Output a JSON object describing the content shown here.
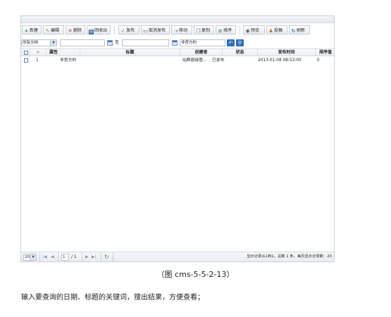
{
  "toolbar": {
    "new": "新建",
    "edit": "编辑",
    "delete": "删除",
    "recycle": "回收站",
    "publish": "发布",
    "unpublish": "取消发布",
    "move": "移动",
    "copy": "复制",
    "sort": "排序",
    "preview": "预览",
    "draft": "投稿",
    "refresh": "刷新"
  },
  "filter": {
    "doc_type": "所有文档",
    "date_from": "",
    "date_to_label": "至",
    "date_to": "",
    "keyword": "非官方的"
  },
  "table": {
    "columns": [
      "属性",
      "标题",
      "创建者",
      "状态",
      "发布时间",
      "排序值"
    ],
    "rows": [
      {
        "index": "1",
        "title": "非官方的",
        "creator": "站群超级管…",
        "status": "已发布",
        "publish_time": "2013-01-08 08:53:00",
        "order": "0"
      }
    ]
  },
  "pager": {
    "page_size": "20",
    "page": "1",
    "total_pages": "/ 1",
    "summary": "显示记录从1到1，总数 1 条，每页显示记录数：20"
  },
  "caption": "（图 cms-5-5-2-13）",
  "description": "输入要查询的日期、标题的关键词，搜出结果，方便查看；"
}
